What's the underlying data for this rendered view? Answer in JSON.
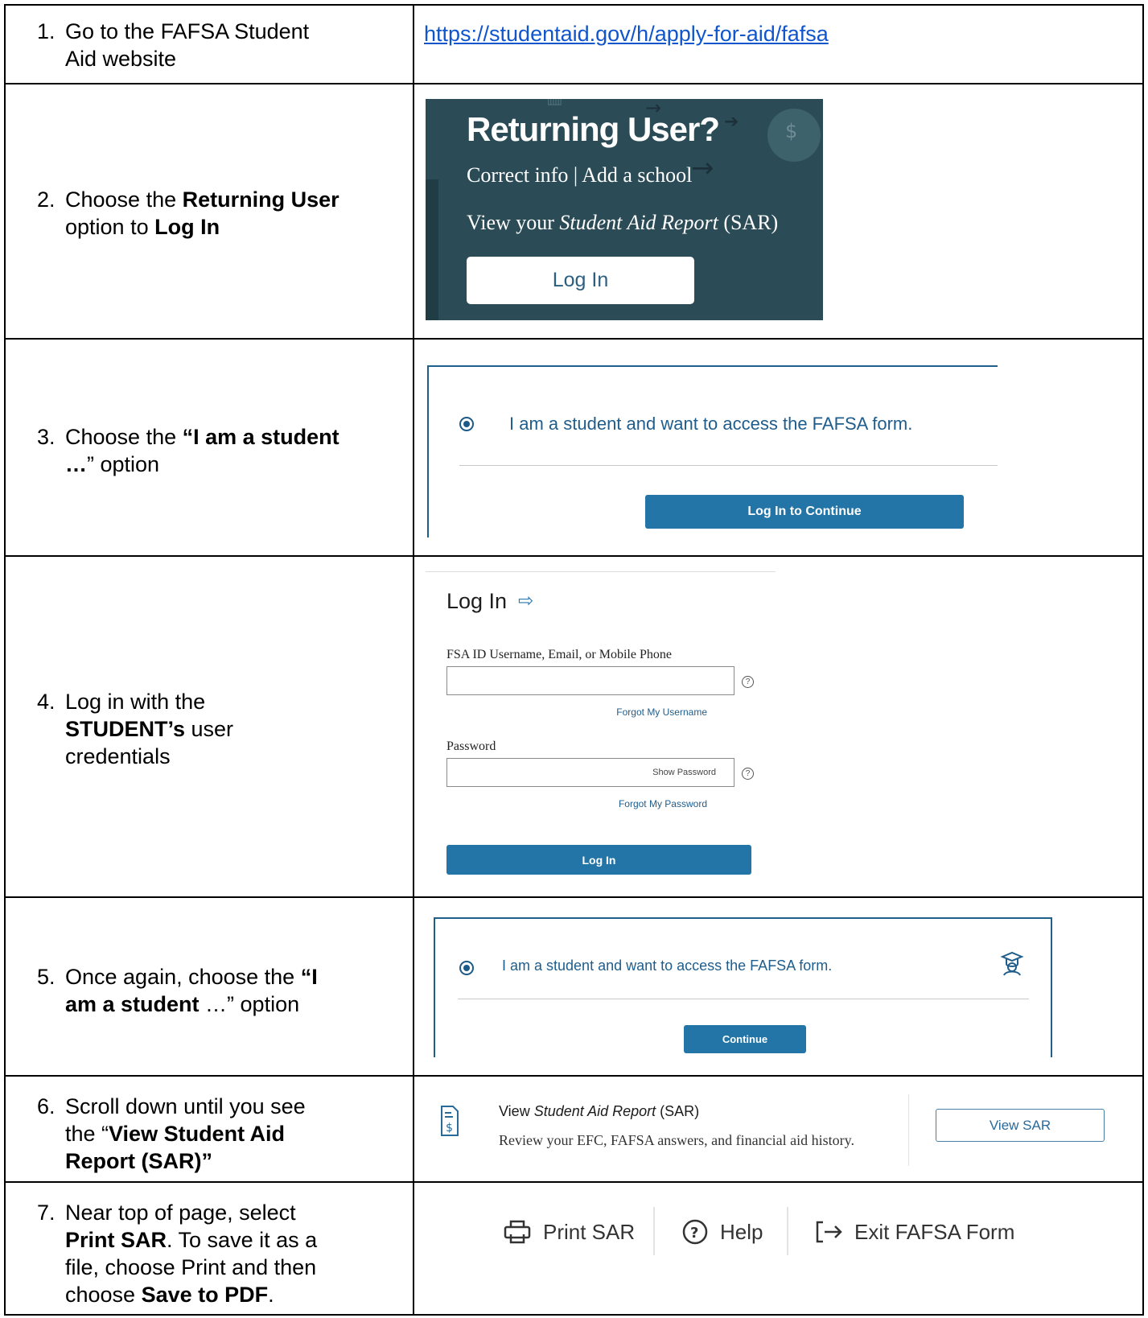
{
  "steps": [
    {
      "num": "1.",
      "lines": [
        "Go to the FAFSA Student",
        "Aid website"
      ]
    },
    {
      "num": "2.",
      "prefix": "Choose the ",
      "bold1": "Returning User",
      "mid": "option to ",
      "bold2": "Log In"
    },
    {
      "num": "3.",
      "prefix": "Choose the ",
      "bold1": "“I am a student",
      "bold2": "…",
      "suffix": "” option"
    },
    {
      "num": "4.",
      "line1": "Log in with the",
      "bold": "STUDENT’s",
      "after": " user",
      "line3": "credentials"
    },
    {
      "num": "5.",
      "line1a": "Once again, choose the ",
      "line1b": "“I",
      "bold": "am a student",
      "suffix": " …” option"
    },
    {
      "num": "6.",
      "line1": "Scroll down until you see",
      "pre": "the “",
      "bold1": "View Student Aid",
      "bold2": "Report (SAR)”"
    },
    {
      "num": "7.",
      "line1": "Near top of page, select",
      "bold1": "Print SAR",
      "after1": ".  To save it as a",
      "line3": "file, choose Print and then",
      "pre4": "choose ",
      "bold4": "Save to PDF",
      "after4": "."
    }
  ],
  "fafsa_link": "https://studentaid.gov/h/apply-for-aid/fafsa",
  "returning_user": {
    "title": "Returning User?",
    "line1": "Correct info | Add a school",
    "line2_pre": "View your ",
    "line2_italic": "Student Aid Report",
    "line2_post": " (SAR)",
    "button": "Log In"
  },
  "student_option_a": {
    "label": "I am a student and want to access the FAFSA form.",
    "button": "Log In to Continue"
  },
  "login_form": {
    "title": "Log In",
    "username_label": "FSA ID Username, Email, or Mobile Phone",
    "forgot_username": "Forgot My Username",
    "password_label": "Password",
    "show_password": "Show Password",
    "forgot_password": "Forgot My Password",
    "submit": "Log In",
    "help_glyph": "?"
  },
  "student_option_b": {
    "label": "I am a student and want to access the FAFSA form.",
    "button": "Continue"
  },
  "sar_panel": {
    "title_pre": "View ",
    "title_italic": "Student Aid Report",
    "title_post": " (SAR)",
    "description": "Review your EFC, FAFSA answers, and financial aid history.",
    "button": "View SAR"
  },
  "toolbar": {
    "print": "Print SAR",
    "help": "Help",
    "exit": "Exit FAFSA Form"
  }
}
